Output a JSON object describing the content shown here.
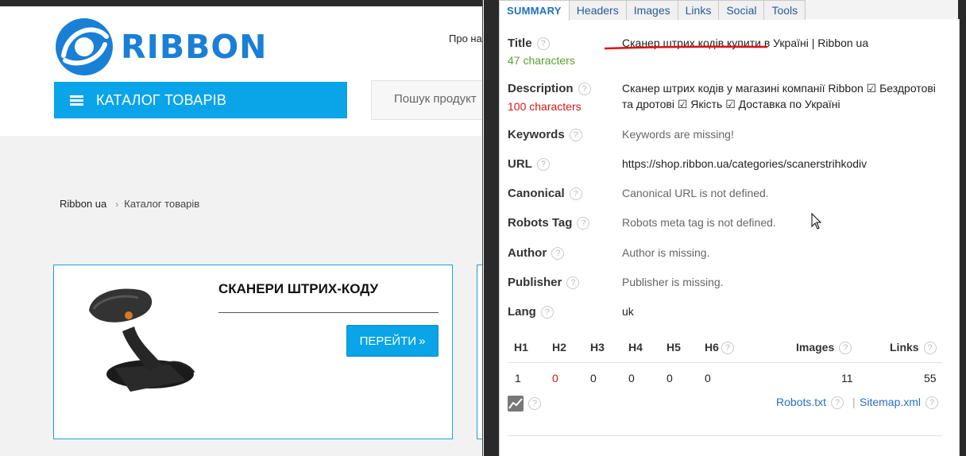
{
  "website": {
    "logo_text": "RIBBON",
    "top_link": "Про на",
    "catalog_label": "КАТАЛОГ ТОВАРІВ",
    "search_placeholder": "Пошук продукт",
    "breadcrumb": [
      "Ribbon ua",
      "Каталог товарів"
    ],
    "product": {
      "title": "СКАНЕРИ ШТРИХ-КОДУ",
      "button": "ПЕРЕЙТИ",
      "button_arrow": "»"
    }
  },
  "seo_panel": {
    "tabs": [
      {
        "label": "SUMMARY",
        "active": true
      },
      {
        "label": "Headers",
        "active": false
      },
      {
        "label": "Images",
        "active": false
      },
      {
        "label": "Links",
        "active": false
      },
      {
        "label": "Social",
        "active": false
      },
      {
        "label": "Tools",
        "active": false
      }
    ],
    "title": {
      "label": "Title",
      "value": "Сканер штрих кодів купити в Україні | Ribbon ua",
      "count": "47 characters"
    },
    "description": {
      "label": "Description",
      "value": "Сканер штрих кодів у магазині компанії Ribbon ☑ Бездротові та дротові ☑ Якість ☑ Доставка по Україні",
      "count": "100 characters"
    },
    "keywords": {
      "label": "Keywords",
      "value": "Keywords are missing!"
    },
    "url": {
      "label": "URL",
      "value": "https://shop.ribbon.ua/categories/scanerstrihkodiv"
    },
    "canonical": {
      "label": "Canonical",
      "value": "Canonical URL is not defined."
    },
    "robots": {
      "label": "Robots Tag",
      "value": "Robots meta tag is not defined."
    },
    "author": {
      "label": "Author",
      "value": "Author is missing."
    },
    "publisher": {
      "label": "Publisher",
      "value": "Publisher is missing."
    },
    "lang": {
      "label": "Lang",
      "value": "uk"
    },
    "headings": {
      "labels": {
        "h1": "H1",
        "h2": "H2",
        "h3": "H3",
        "h4": "H4",
        "h5": "H5",
        "h6": "H6",
        "images": "Images",
        "links": "Links"
      },
      "values": {
        "h1": "1",
        "h2": "0",
        "h3": "0",
        "h4": "0",
        "h5": "0",
        "h6": "0",
        "images": "11",
        "links": "55"
      }
    },
    "robots_txt": "Robots.txt",
    "separator": "|",
    "sitemap": "Sitemap.xml",
    "help_glyph": "?"
  },
  "colors": {
    "brand_blue": "#0aa4e8",
    "link_blue": "#2a6fbf",
    "ok_green": "#5aa02c",
    "warn_red": "#d41616"
  }
}
